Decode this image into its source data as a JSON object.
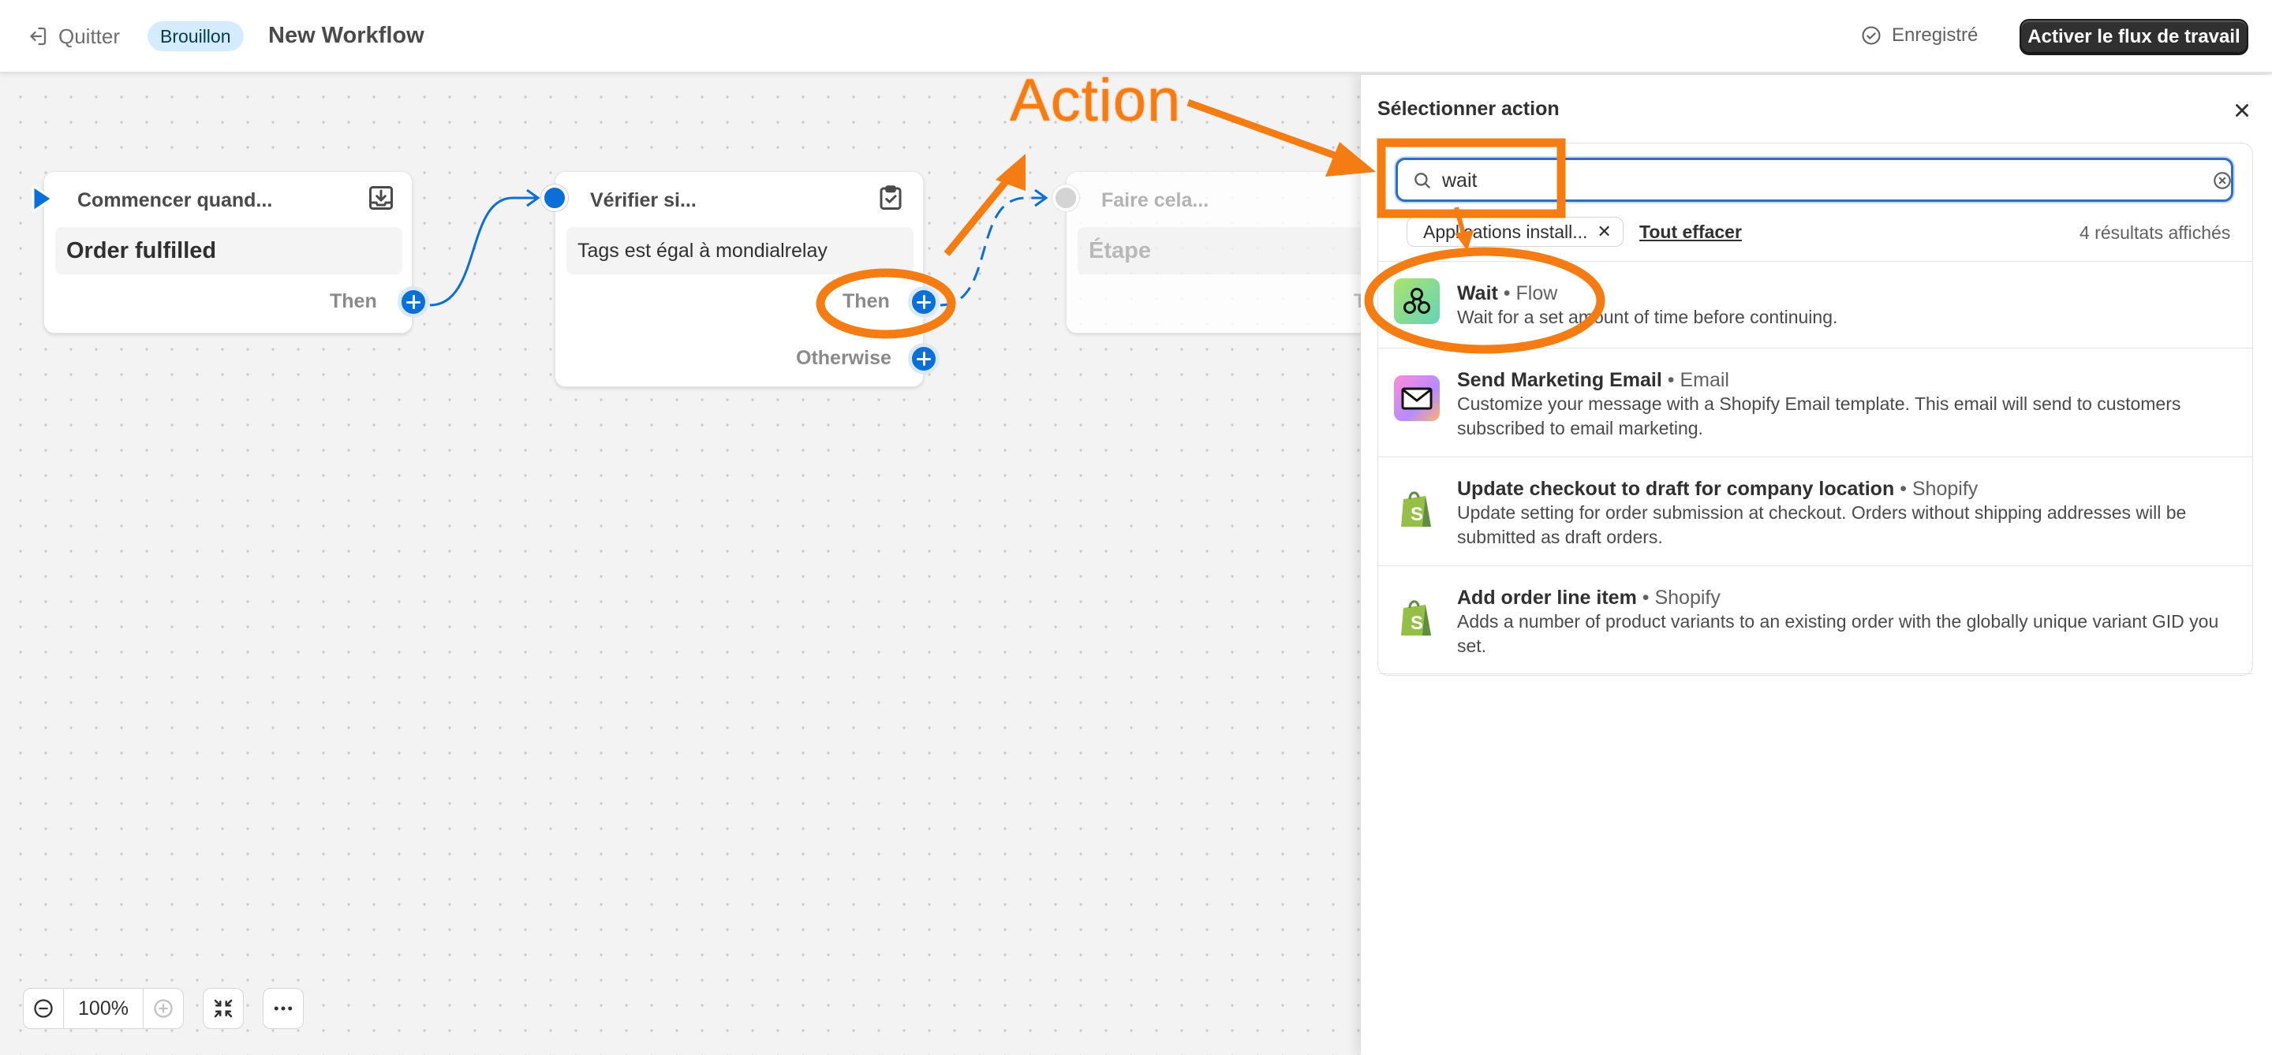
{
  "topbar": {
    "quit_label": "Quitter",
    "status_badge": "Brouillon",
    "workflow_title": "New Workflow",
    "saved_label": "Enregistré",
    "activate_label": "Activer le flux de travail"
  },
  "canvas": {
    "trigger": {
      "header": "Commencer quand...",
      "event": "Order fulfilled",
      "then_label": "Then"
    },
    "condition": {
      "header": "Vérifier si...",
      "rule": "Tags est égal à mondialrelay",
      "then_label": "Then",
      "otherwise_label": "Otherwise"
    },
    "action": {
      "header": "Faire cela...",
      "placeholder": "Étape",
      "then_label": "T"
    },
    "zoom_level": "100%"
  },
  "panel": {
    "title": "Sélectionner action",
    "search_value": "wait",
    "filter_chip": "Applications install...",
    "clear_all": "Tout effacer",
    "results_count": "4 résultats affichés",
    "results": [
      {
        "title": "Wait",
        "source": "• Flow",
        "description": "Wait for a set amount of time before continuing.",
        "icon": "flow-app-icon"
      },
      {
        "title": "Send Marketing Email",
        "source": "• Email",
        "description": "Customize your message with a Shopify Email template. This email will send to customers subscribed to email marketing.",
        "icon": "email-app-icon"
      },
      {
        "title": "Update checkout to draft for company location",
        "source": "• Shopify",
        "description": "Update setting for order submission at checkout. Orders without shipping addresses will be submitted as draft orders.",
        "icon": "shopify-bag-icon"
      },
      {
        "title": "Add order line item",
        "source": "• Shopify",
        "description": "Adds a number of product variants to an existing order with the globally unique variant GID you set.",
        "icon": "shopify-bag-icon"
      }
    ]
  },
  "annotation": {
    "label": "Action",
    "color": "#f57c12"
  },
  "colors": {
    "accent": "#0a6fd8",
    "primary_button": "#303030",
    "badge_bg": "#d5ebff",
    "search_focus": "#2c6ecb",
    "annotation": "#f57c12"
  }
}
